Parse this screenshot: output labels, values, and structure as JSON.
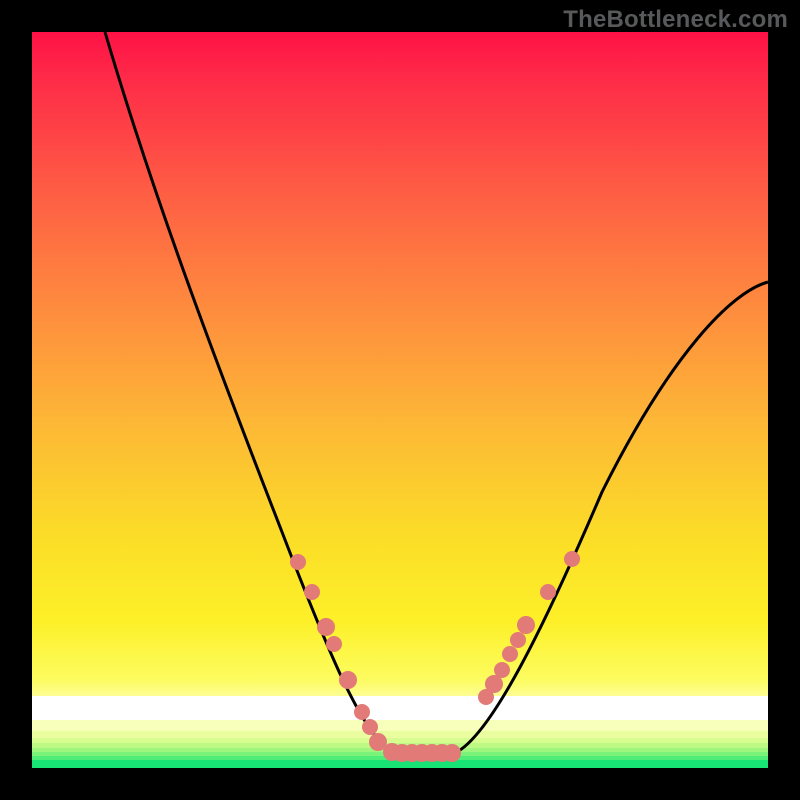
{
  "watermark": "TheBottleneck.com",
  "chart_data": {
    "type": "line",
    "title": "",
    "xlabel": "",
    "ylabel": "",
    "xlim": [
      0,
      100
    ],
    "ylim": [
      0,
      100
    ],
    "series": [
      {
        "name": "left-curve",
        "x": [
          10,
          15,
          20,
          25,
          30,
          35,
          40,
          45,
          48
        ],
        "y": [
          100,
          85,
          70,
          56,
          43,
          31,
          19,
          8,
          2
        ]
      },
      {
        "name": "floor",
        "x": [
          48,
          58
        ],
        "y": [
          2,
          2
        ]
      },
      {
        "name": "right-curve",
        "x": [
          58,
          62,
          68,
          75,
          82,
          90,
          100
        ],
        "y": [
          2,
          8,
          18,
          30,
          42,
          53,
          66
        ]
      }
    ],
    "markers": {
      "name": "highlighted-points",
      "color": "#e27a77",
      "points": [
        {
          "x": 36,
          "y": 28
        },
        {
          "x": 38,
          "y": 24
        },
        {
          "x": 40,
          "y": 19
        },
        {
          "x": 41,
          "y": 17
        },
        {
          "x": 43,
          "y": 12
        },
        {
          "x": 45,
          "y": 8
        },
        {
          "x": 46,
          "y": 6
        },
        {
          "x": 47,
          "y": 3
        },
        {
          "x": 49,
          "y": 2
        },
        {
          "x": 50,
          "y": 2
        },
        {
          "x": 51,
          "y": 2
        },
        {
          "x": 52,
          "y": 2
        },
        {
          "x": 53,
          "y": 2
        },
        {
          "x": 54,
          "y": 2
        },
        {
          "x": 55,
          "y": 2
        },
        {
          "x": 56,
          "y": 2
        },
        {
          "x": 57,
          "y": 2
        },
        {
          "x": 62,
          "y": 8
        },
        {
          "x": 63,
          "y": 9
        },
        {
          "x": 64,
          "y": 12
        },
        {
          "x": 65,
          "y": 14
        },
        {
          "x": 66,
          "y": 16
        },
        {
          "x": 67,
          "y": 17
        },
        {
          "x": 70,
          "y": 22
        },
        {
          "x": 73,
          "y": 27
        }
      ]
    },
    "background_bands": [
      {
        "y_from": 0,
        "y_to": 1.0,
        "color": "#18e475"
      },
      {
        "y_from": 1.0,
        "y_to": 1.6,
        "color": "#4fec77"
      },
      {
        "y_from": 1.6,
        "y_to": 2.2,
        "color": "#7bf27a"
      },
      {
        "y_from": 2.2,
        "y_to": 2.8,
        "color": "#9ff67e"
      },
      {
        "y_from": 2.8,
        "y_to": 3.4,
        "color": "#bdfa84"
      },
      {
        "y_from": 3.4,
        "y_to": 4.0,
        "color": "#d7fc8f"
      },
      {
        "y_from": 4.0,
        "y_to": 5.0,
        "color": "#eafe9f"
      },
      {
        "y_from": 5.0,
        "y_to": 6.5,
        "color": "#f8ffbb"
      },
      {
        "y_from": 6.5,
        "y_to": 9.8,
        "color": "#ffffff"
      }
    ]
  }
}
